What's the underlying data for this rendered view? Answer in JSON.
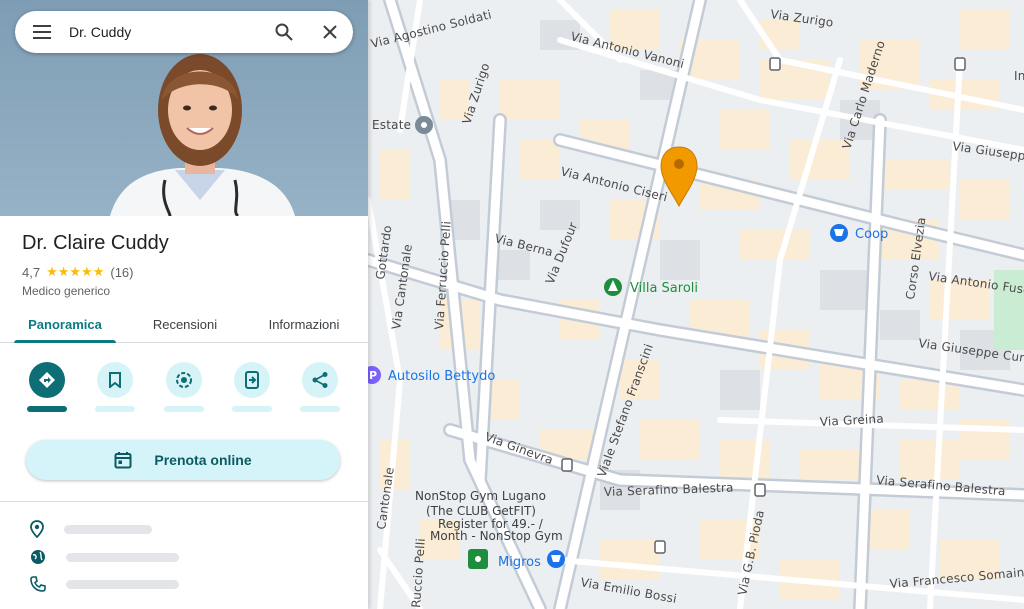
{
  "search": {
    "query": "Dr. Cuddy"
  },
  "place": {
    "name": "Dr. Claire Cuddy",
    "rating": "4,7",
    "stars": "★★★★★",
    "review_count": "(16)",
    "category": "Medico generico"
  },
  "tabs": [
    {
      "label": "Panoramica",
      "active": true
    },
    {
      "label": "Recensioni",
      "active": false
    },
    {
      "label": "Informazioni",
      "active": false
    }
  ],
  "actions": [
    {
      "icon": "directions-icon",
      "primary": true
    },
    {
      "icon": "bookmark-icon",
      "primary": false
    },
    {
      "icon": "nearby-icon",
      "primary": false
    },
    {
      "icon": "send-to-phone-icon",
      "primary": false
    },
    {
      "icon": "share-icon",
      "primary": false
    }
  ],
  "booking": {
    "label": "Prenota online",
    "icon": "calendar-icon"
  },
  "info_rows": [
    {
      "icon": "location-pin-icon"
    },
    {
      "icon": "globe-icon"
    },
    {
      "icon": "phone-icon"
    }
  ],
  "colors": {
    "accent": "#0d6e76",
    "accent_light": "#d6f3f7",
    "map_marker": "#f29900",
    "park_green": "#1e8e3e",
    "shop_blue": "#1a73e8"
  },
  "map": {
    "streets": [
      "Via Zurigo",
      "Via Antonio Vanoni",
      "Via Carlo Maderno",
      "Via Giuseppe",
      "Via Antonio Ciseri",
      "Via Berna",
      "Via Dufour",
      "Via Zurigo",
      "Via Ferruccio Pelli",
      "Via Cantonale",
      "Via Antonio Fusoni",
      "Via Giuseppe Curti",
      "Corso Elvezia",
      "Viale Stefano Franscini",
      "Via Greina",
      "Via Serafino Balestra",
      "Via Serafino Balestra",
      "Via Ginevra",
      "Via G.B. Pioda",
      "Via Emilio Bossi",
      "Via Francesco Somaini",
      "Via Agostino Soldati",
      "Inf",
      "Ruccio Pelli",
      "Cantonale",
      "Gottardo"
    ],
    "pois": {
      "estate": "Estate",
      "villa_saroli": "Villa Saroli",
      "coop": "Coop",
      "autosilo": "Autosilo Bettydo",
      "gym_line1": "NonStop Gym Lugano",
      "gym_line2": "(The CLUB GetFIT)",
      "gym_line3": "Register for 49.- /",
      "gym_line4": "Month - NonStop Gym",
      "migros": "Migros"
    }
  }
}
